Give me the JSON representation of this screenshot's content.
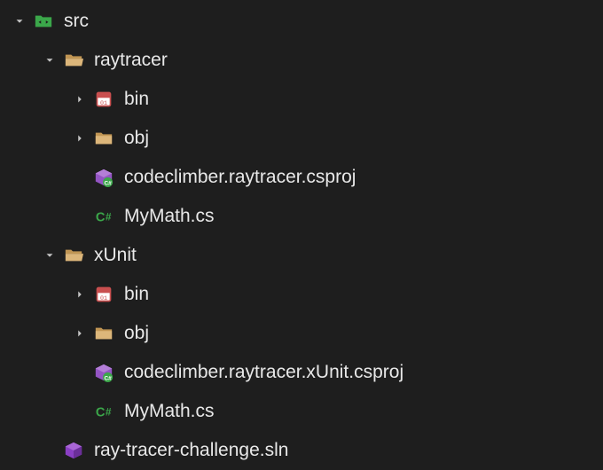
{
  "tree": {
    "src": "src",
    "raytracer": "raytracer",
    "raytracer_bin": "bin",
    "raytracer_obj": "obj",
    "raytracer_csproj": "codeclimber.raytracer.csproj",
    "raytracer_mymath": "MyMath.cs",
    "xunit": "xUnit",
    "xunit_bin": "bin",
    "xunit_obj": "obj",
    "xunit_csproj": "codeclimber.raytracer.xUnit.csproj",
    "xunit_mymath": "MyMath.cs",
    "sln": "ray-tracer-challenge.sln"
  },
  "colors": {
    "folder": "#dcb67a",
    "src_green": "#3ba74a",
    "binary_red": "#c94f4f",
    "csproj_purple": "#9455c4",
    "csharp_green": "#3ba74a",
    "sln_purple": "#8a3fc4"
  }
}
